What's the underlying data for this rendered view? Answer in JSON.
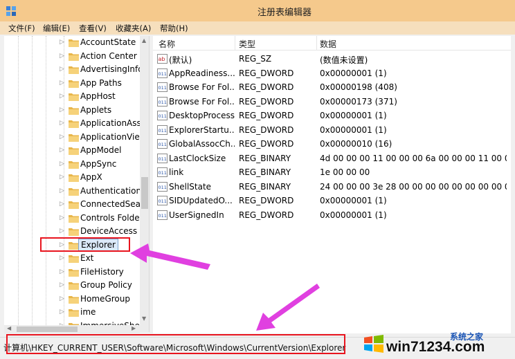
{
  "window": {
    "title": "注册表编辑器"
  },
  "menu": [
    "文件(F)",
    "编辑(E)",
    "查看(V)",
    "收藏夹(A)",
    "帮助(H)"
  ],
  "tree": {
    "items": [
      {
        "label": "AccountState"
      },
      {
        "label": "Action Center"
      },
      {
        "label": "AdvertisingInfo"
      },
      {
        "label": "App Paths"
      },
      {
        "label": "AppHost"
      },
      {
        "label": "Applets"
      },
      {
        "label": "ApplicationAss"
      },
      {
        "label": "ApplicationVie"
      },
      {
        "label": "AppModel"
      },
      {
        "label": "AppSync"
      },
      {
        "label": "AppX"
      },
      {
        "label": "Authentication"
      },
      {
        "label": "ConnectedSea"
      },
      {
        "label": "Controls Folde"
      },
      {
        "label": "DeviceAccess"
      },
      {
        "label": "Explorer",
        "selected": true
      },
      {
        "label": "Ext"
      },
      {
        "label": "FileHistory"
      },
      {
        "label": "Group Policy"
      },
      {
        "label": "HomeGroup"
      },
      {
        "label": "ime"
      },
      {
        "label": "ImmersiveShel"
      }
    ]
  },
  "list": {
    "columns": [
      "名称",
      "类型",
      "数据"
    ],
    "rows": [
      {
        "icon": "string-value-icon",
        "name": "(默认)",
        "type": "REG_SZ",
        "data": "(数值未设置)"
      },
      {
        "icon": "binary-value-icon",
        "name": "AppReadiness...",
        "type": "REG_DWORD",
        "data": "0x00000001 (1)"
      },
      {
        "icon": "binary-value-icon",
        "name": "Browse For Fol...",
        "type": "REG_DWORD",
        "data": "0x00000198 (408)"
      },
      {
        "icon": "binary-value-icon",
        "name": "Browse For Fol...",
        "type": "REG_DWORD",
        "data": "0x00000173 (371)"
      },
      {
        "icon": "binary-value-icon",
        "name": "DesktopProcess",
        "type": "REG_DWORD",
        "data": "0x00000001 (1)"
      },
      {
        "icon": "binary-value-icon",
        "name": "ExplorerStartu...",
        "type": "REG_DWORD",
        "data": "0x00000001 (1)"
      },
      {
        "icon": "binary-value-icon",
        "name": "GlobalAssocCh...",
        "type": "REG_DWORD",
        "data": "0x00000010 (16)"
      },
      {
        "icon": "binary-value-icon",
        "name": "LastClockSize",
        "type": "REG_BINARY",
        "data": "4d 00 00 00 11 00 00 00 6a 00 00 00 11 00 00..."
      },
      {
        "icon": "binary-value-icon",
        "name": "link",
        "type": "REG_BINARY",
        "data": "1e 00 00 00"
      },
      {
        "icon": "binary-value-icon",
        "name": "ShellState",
        "type": "REG_BINARY",
        "data": "24 00 00 00 3e 28 00 00 00 00 00 00 00 00 00..."
      },
      {
        "icon": "binary-value-icon",
        "name": "SIDUpdatedO...",
        "type": "REG_DWORD",
        "data": "0x00000001 (1)"
      },
      {
        "icon": "binary-value-icon",
        "name": "UserSignedIn",
        "type": "REG_DWORD",
        "data": "0x00000001 (1)"
      }
    ]
  },
  "status": {
    "path": "计算机\\HKEY_CURRENT_USER\\Software\\Microsoft\\Windows\\CurrentVersion\\Explorer"
  },
  "watermark": {
    "text": "win71234.com",
    "cn": "系统之家"
  },
  "colors": {
    "titlebar": "#f5c98c",
    "highlight_box": "#e8141e",
    "arrow": "#e040e0",
    "selection": "#dbe9f9"
  }
}
